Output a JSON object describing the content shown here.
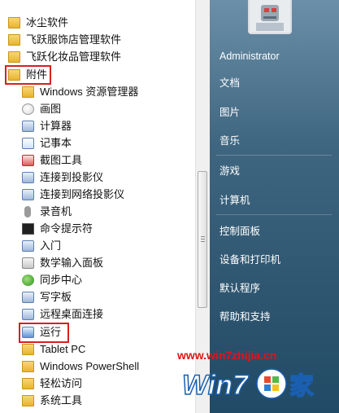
{
  "programs": [
    {
      "label": "冰尘软件",
      "icon": "folder-icon"
    },
    {
      "label": "飞跃服饰店管理软件",
      "icon": "folder-icon"
    },
    {
      "label": "飞跃化妆品管理软件",
      "icon": "folder-icon"
    },
    {
      "label": "附件",
      "icon": "folder-icon"
    },
    {
      "label": "Windows 资源管理器",
      "icon": "explorer-icon"
    },
    {
      "label": "画图",
      "icon": "paint-icon"
    },
    {
      "label": "计算器",
      "icon": "calculator-icon"
    },
    {
      "label": "记事本",
      "icon": "notepad-icon"
    },
    {
      "label": "截图工具",
      "icon": "snipping-icon"
    },
    {
      "label": "连接到投影仪",
      "icon": "projector-icon"
    },
    {
      "label": "连接到网络投影仪",
      "icon": "network-projector-icon"
    },
    {
      "label": "录音机",
      "icon": "microphone-icon"
    },
    {
      "label": "命令提示符",
      "icon": "cmd-icon"
    },
    {
      "label": "入门",
      "icon": "getting-started-icon"
    },
    {
      "label": "数学输入面板",
      "icon": "math-panel-icon"
    },
    {
      "label": "同步中心",
      "icon": "sync-icon"
    },
    {
      "label": "写字板",
      "icon": "wordpad-icon"
    },
    {
      "label": "远程桌面连接",
      "icon": "remote-desktop-icon"
    },
    {
      "label": "运行",
      "icon": "run-icon"
    },
    {
      "label": "Tablet PC",
      "icon": "folder-icon"
    },
    {
      "label": "Windows PowerShell",
      "icon": "folder-icon"
    },
    {
      "label": "轻松访问",
      "icon": "folder-icon"
    },
    {
      "label": "系统工具",
      "icon": "folder-icon"
    }
  ],
  "right_panel": {
    "user": "Administrator",
    "documents": "文档",
    "pictures": "图片",
    "music": "音乐",
    "games": "游戏",
    "computer": "计算机",
    "control_panel": "控制面板",
    "devices_printers": "设备和打印机",
    "default_programs": "默认程序",
    "help_support": "帮助和支持"
  },
  "watermark": {
    "url": "www.win7zhijia.cn",
    "logo_text_1": "Win7",
    "logo_text_2": "家"
  },
  "colors": {
    "highlight_box": "#d62020",
    "right_panel": "#3f6680",
    "watermark_text": "#e01515"
  }
}
